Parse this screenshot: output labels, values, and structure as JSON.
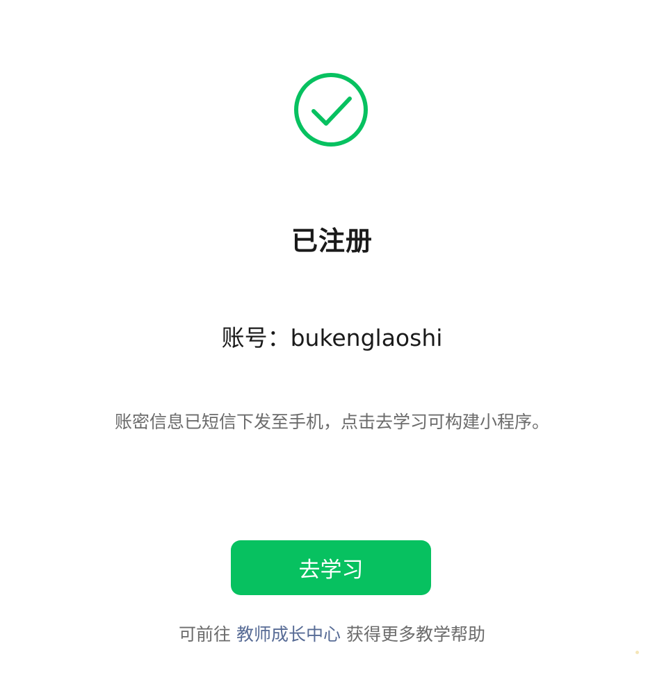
{
  "status": {
    "icon": "check-circle-icon",
    "accent_color": "#07c160",
    "title": "已注册"
  },
  "account": {
    "label": "账号：",
    "value": "bukenglaoshi"
  },
  "message": "账密信息已短信下发至手机，点击去学习可构建小程序。",
  "actions": {
    "primary_label": "去学习"
  },
  "footer": {
    "prefix": "可前往",
    "link_text": "教师成长中心",
    "suffix": "获得更多教学帮助",
    "link_color": "#576b95"
  }
}
